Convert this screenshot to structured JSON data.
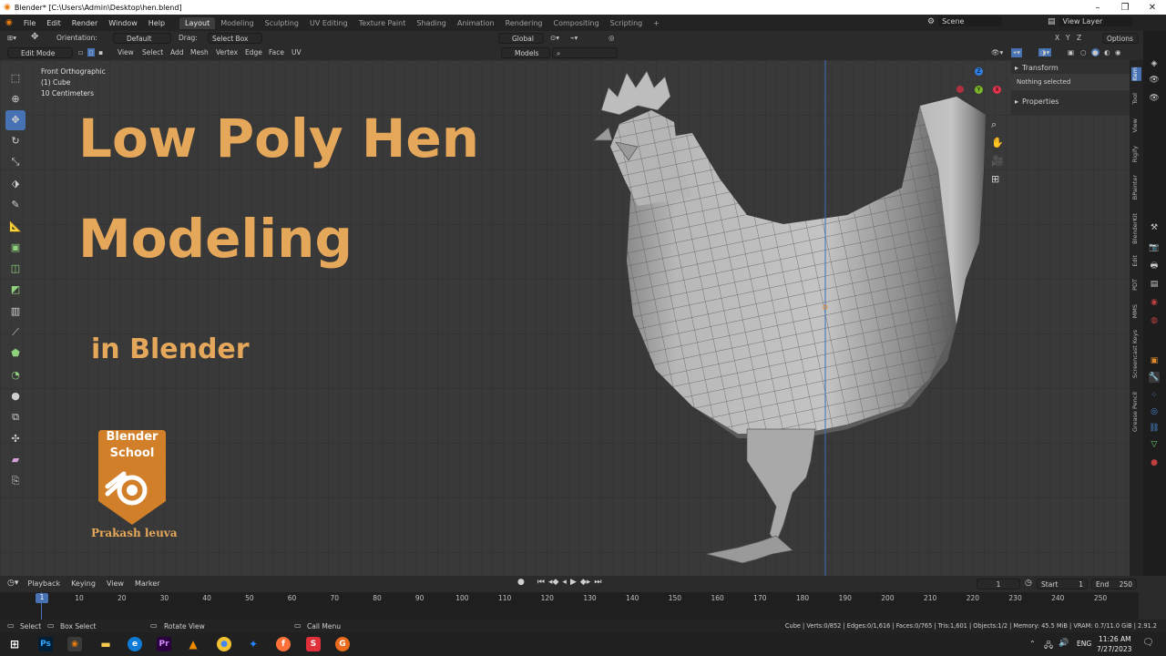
{
  "window": {
    "title": "Blender* [C:\\Users\\Admin\\Desktop\\hen.blend]",
    "controls": [
      "minimize-icon",
      "restore-icon",
      "close-icon"
    ]
  },
  "menu": [
    "File",
    "Edit",
    "Render",
    "Window",
    "Help"
  ],
  "workspaces": [
    "Layout",
    "Modeling",
    "Sculpting",
    "UV Editing",
    "Texture Paint",
    "Shading",
    "Animation",
    "Rendering",
    "Compositing",
    "Scripting"
  ],
  "active_workspace": "Layout",
  "scene": "Scene",
  "view_layer": "View Layer",
  "tool_header": {
    "orientation_label": "Orientation:",
    "orientation_value": "Default",
    "drag_label": "Drag:",
    "drag_value": "Select Box",
    "transform_orientation": "Global",
    "options_label": "Options",
    "axes": [
      "X",
      "Y",
      "Z"
    ]
  },
  "edit_header": {
    "mode": "Edit Mode",
    "menus": [
      "View",
      "Select",
      "Add",
      "Mesh",
      "Vertex",
      "Edge",
      "Face",
      "UV"
    ],
    "models_dropdown": "Models"
  },
  "viewport_info": {
    "view": "Front Orthographic",
    "object": "(1) Cube",
    "scale": "10 Centimeters"
  },
  "overlay_text": {
    "title_line1": "Low Poly Hen",
    "title_line2": "Modeling",
    "subtitle": "in Blender",
    "badge_line1": "Blender",
    "badge_line2": "School",
    "author": "Prakash leuva"
  },
  "gizmo": {
    "x": "X",
    "y": "Y",
    "z": "Z"
  },
  "npanel": {
    "transform_header": "Transform",
    "transform_body": "Nothing selected",
    "properties_header": "Properties"
  },
  "vertical_tabs": [
    "Item",
    "Tool",
    "View",
    "Rigify",
    "BPainter",
    "BlenderKit",
    "Edit",
    "PDT",
    "MMS",
    "Screencast Keys",
    "Grease Pencil"
  ],
  "timeline": {
    "menus": [
      "Playback",
      "Keying",
      "View",
      "Marker"
    ],
    "current_frame": "1",
    "start_label": "Start",
    "start_value": "1",
    "end_label": "End",
    "end_value": "250",
    "ticks": [
      "1",
      "10",
      "20",
      "30",
      "40",
      "50",
      "60",
      "70",
      "80",
      "90",
      "100",
      "110",
      "120",
      "130",
      "140",
      "150",
      "160",
      "170",
      "180",
      "190",
      "200",
      "210",
      "220",
      "230",
      "240",
      "250"
    ]
  },
  "statusbar": {
    "select": "Select",
    "box_select": "Box Select",
    "rotate_view": "Rotate View",
    "call_menu": "Call Menu",
    "stats": "Cube | Verts:0/852 | Edges:0/1,616 | Faces:0/765 | Tris:1,601 | Objects:1/2 | Memory: 45.5 MiB | VRAM: 0.7/11.0 GiB | 2.91.2"
  },
  "taskbar": {
    "time": "11:26 AM",
    "date": "7/27/2023",
    "language": "ENG",
    "apps": [
      "windows-start-icon",
      "photoshop-icon",
      "blender-icon",
      "file-explorer-icon",
      "edge-icon",
      "premiere-icon",
      "vlc-icon",
      "chrome-icon",
      "sourcetree-icon",
      "firefox-icon",
      "app-s-icon",
      "app-g-icon"
    ]
  },
  "colors": {
    "accent_blue": "#4772b3",
    "title_orange": "#e5a75a",
    "badge_orange": "#d27f2a",
    "viewport_bg": "#393939"
  }
}
